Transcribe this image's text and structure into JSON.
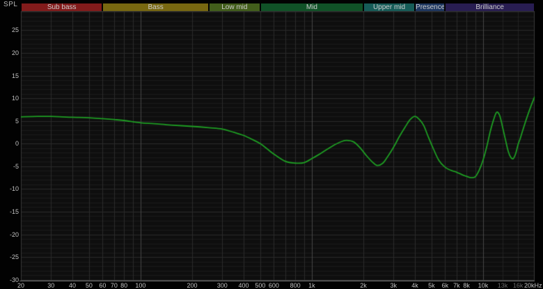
{
  "labels": {
    "spl": "SPL"
  },
  "colors": {
    "background": "#020202",
    "plot_background": "#0e0e0e",
    "grid_minor": "#1a1a1a",
    "grid_major": "#2b2b2b",
    "grid_faint": "#232323",
    "grid_decade": "#474747",
    "plot_border": "#3a3a3a",
    "axis_line": "#7a7a7a",
    "curve": "#1e9e23",
    "tick_text": "#c2c2c2",
    "tick_text_dim": "#696969",
    "band_text": "#cccccc"
  },
  "bands": [
    {
      "label": "Sub bass",
      "from_hz": 20,
      "to_hz": 60,
      "color": "#821b1b"
    },
    {
      "label": "Bass",
      "from_hz": 60,
      "to_hz": 250,
      "color": "#786810"
    },
    {
      "label": "Low mid",
      "from_hz": 250,
      "to_hz": 500,
      "color": "#425e1b"
    },
    {
      "label": "Mid",
      "from_hz": 500,
      "to_hz": 2000,
      "color": "#105227"
    },
    {
      "label": "Upper mid",
      "from_hz": 2000,
      "to_hz": 4000,
      "color": "#165c58"
    },
    {
      "label": "Presence",
      "from_hz": 4000,
      "to_hz": 6000,
      "color": "#1d3660"
    },
    {
      "label": "Brilliance",
      "from_hz": 6000,
      "to_hz": 20000,
      "color": "#281d52"
    }
  ],
  "axis": {
    "x": {
      "scale": "log",
      "min_hz": 20,
      "max_hz": 20000,
      "ticks": [
        {
          "hz": 20,
          "label": "20",
          "dim": false
        },
        {
          "hz": 30,
          "label": "30",
          "dim": false
        },
        {
          "hz": 40,
          "label": "40",
          "dim": false
        },
        {
          "hz": 50,
          "label": "50",
          "dim": false
        },
        {
          "hz": 60,
          "label": "60",
          "dim": false
        },
        {
          "hz": 70,
          "label": "70",
          "dim": false
        },
        {
          "hz": 80,
          "label": "80",
          "dim": false
        },
        {
          "hz": 100,
          "label": "100",
          "dim": false
        },
        {
          "hz": 200,
          "label": "200",
          "dim": false
        },
        {
          "hz": 300,
          "label": "300",
          "dim": false
        },
        {
          "hz": 400,
          "label": "400",
          "dim": false
        },
        {
          "hz": 500,
          "label": "500",
          "dim": false
        },
        {
          "hz": 600,
          "label": "600",
          "dim": false
        },
        {
          "hz": 800,
          "label": "800",
          "dim": false
        },
        {
          "hz": 1000,
          "label": "1k",
          "dim": false
        },
        {
          "hz": 2000,
          "label": "2k",
          "dim": false
        },
        {
          "hz": 3000,
          "label": "3k",
          "dim": false
        },
        {
          "hz": 4000,
          "label": "4k",
          "dim": false
        },
        {
          "hz": 5000,
          "label": "5k",
          "dim": false
        },
        {
          "hz": 6000,
          "label": "6k",
          "dim": false
        },
        {
          "hz": 7000,
          "label": "7k",
          "dim": false
        },
        {
          "hz": 8000,
          "label": "8k",
          "dim": false
        },
        {
          "hz": 10000,
          "label": "10k",
          "dim": false
        },
        {
          "hz": 13000,
          "label": "13k",
          "dim": true
        },
        {
          "hz": 16000,
          "label": "16k",
          "dim": true
        },
        {
          "hz": 20000,
          "label": "20kHz",
          "dim": false
        }
      ],
      "extra_faint_gridlines_hz": [
        13000,
        16000
      ],
      "decade_gridlines_hz": [
        100,
        1000,
        10000
      ]
    },
    "y": {
      "unit": "dB SPL",
      "major_step_db": 5,
      "minor_step_db": 1,
      "tick_labels": [
        "25",
        "20",
        "15",
        "10",
        "5",
        "0",
        "-5",
        "-10",
        "-15",
        "-20",
        "-25",
        "-30"
      ],
      "tick_values": [
        25,
        20,
        15,
        10,
        5,
        0,
        -5,
        -10,
        -15,
        -20,
        -25,
        -30
      ]
    }
  },
  "chart_data": {
    "type": "line",
    "title": "",
    "xlabel": "",
    "ylabel": "SPL",
    "x_scale": "log",
    "x_range_hz": [
      20,
      20000
    ],
    "y_range_db": [
      -30,
      29
    ],
    "grid": true,
    "legend": "none",
    "series": [
      {
        "name": "SPL",
        "color": "#1e9e23",
        "points": [
          [
            20,
            5.9
          ],
          [
            25,
            6.0
          ],
          [
            30,
            6.0
          ],
          [
            35,
            5.9
          ],
          [
            40,
            5.8
          ],
          [
            50,
            5.7
          ],
          [
            60,
            5.5
          ],
          [
            70,
            5.3
          ],
          [
            80,
            5.1
          ],
          [
            100,
            4.6
          ],
          [
            120,
            4.4
          ],
          [
            150,
            4.1
          ],
          [
            200,
            3.8
          ],
          [
            250,
            3.5
          ],
          [
            300,
            3.2
          ],
          [
            350,
            2.5
          ],
          [
            400,
            1.8
          ],
          [
            450,
            0.9
          ],
          [
            500,
            0.0
          ],
          [
            550,
            -1.2
          ],
          [
            600,
            -2.3
          ],
          [
            700,
            -3.9
          ],
          [
            800,
            -4.3
          ],
          [
            900,
            -4.2
          ],
          [
            1000,
            -3.3
          ],
          [
            1100,
            -2.4
          ],
          [
            1200,
            -1.5
          ],
          [
            1350,
            -0.3
          ],
          [
            1500,
            0.5
          ],
          [
            1600,
            0.7
          ],
          [
            1750,
            0.4
          ],
          [
            1900,
            -0.8
          ],
          [
            2100,
            -2.8
          ],
          [
            2250,
            -4.0
          ],
          [
            2400,
            -4.8
          ],
          [
            2600,
            -4.3
          ],
          [
            2800,
            -2.6
          ],
          [
            3000,
            -0.8
          ],
          [
            3250,
            1.6
          ],
          [
            3500,
            3.6
          ],
          [
            3750,
            5.3
          ],
          [
            4000,
            6.0
          ],
          [
            4250,
            5.3
          ],
          [
            4500,
            4.0
          ],
          [
            4750,
            1.8
          ],
          [
            5000,
            -0.2
          ],
          [
            5500,
            -3.6
          ],
          [
            6000,
            -5.2
          ],
          [
            6500,
            -5.9
          ],
          [
            7000,
            -6.3
          ],
          [
            7500,
            -6.8
          ],
          [
            8000,
            -7.2
          ],
          [
            8500,
            -7.5
          ],
          [
            9000,
            -7.3
          ],
          [
            9500,
            -5.8
          ],
          [
            10000,
            -3.6
          ],
          [
            10500,
            -0.7
          ],
          [
            11000,
            2.6
          ],
          [
            11500,
            5.2
          ],
          [
            12000,
            6.9
          ],
          [
            12500,
            6.2
          ],
          [
            13000,
            3.6
          ],
          [
            13500,
            0.9
          ],
          [
            14000,
            -1.6
          ],
          [
            14500,
            -3.0
          ],
          [
            15000,
            -3.3
          ],
          [
            15500,
            -2.2
          ],
          [
            16000,
            -0.2
          ],
          [
            16500,
            1.2
          ],
          [
            17000,
            2.8
          ],
          [
            18000,
            5.7
          ],
          [
            19000,
            8.2
          ],
          [
            20000,
            10.3
          ]
        ]
      }
    ]
  }
}
